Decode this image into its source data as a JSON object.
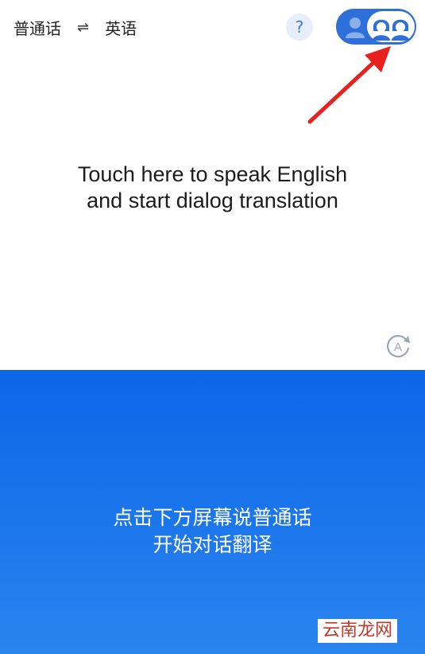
{
  "header": {
    "source_lang": "普通话",
    "swap_symbol": "⇌",
    "target_lang": "英语",
    "help_symbol": "?",
    "mode_toggle": {
      "selected": "dialog",
      "icons": [
        "person-icon",
        "two-people-icon"
      ]
    }
  },
  "upper_panel": {
    "prompt_line1": "Touch here to speak English",
    "prompt_line2": "and start dialog translation",
    "auto_icon": "auto-rotate-icon"
  },
  "lower_panel": {
    "prompt_line1": "点击下方屏幕说普通话",
    "prompt_line2": "开始对话翻译",
    "watermark": "云南龙网"
  },
  "colors": {
    "accent": "#2f6fd9",
    "bottom_gradient_top": "#0c66e8",
    "bottom_gradient_bottom": "#2a84ee",
    "annotation_arrow": "#e8201e",
    "watermark_text": "#c0392b"
  }
}
